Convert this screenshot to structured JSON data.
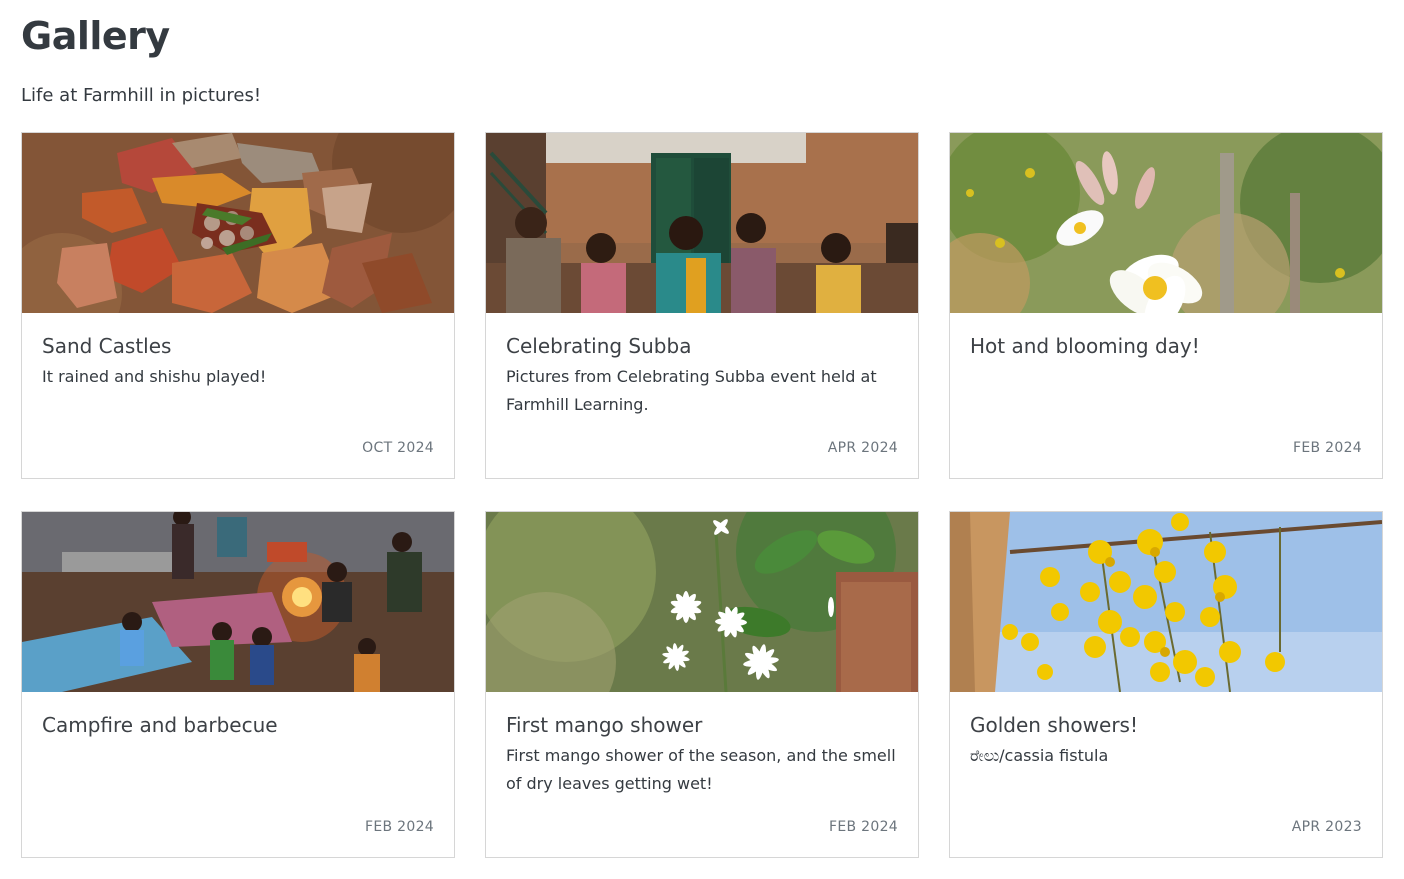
{
  "header": {
    "title": "Gallery",
    "subtitle": "Life at Farmhill in pictures!"
  },
  "cards": [
    {
      "title": "Sand Castles",
      "description": "It rained and shishu played!",
      "date": "OCT 2024",
      "image": "photo-leaves-and-stones-on-soil"
    },
    {
      "title": "Celebrating Subba",
      "description": "Pictures from Celebrating Subba event held at Farmhill Learning.",
      "date": "APR 2024",
      "image": "photo-people-sitting-outside-brick-building"
    },
    {
      "title": "Hot and blooming day!",
      "description": "",
      "date": "FEB 2024",
      "image": "photo-white-frangipani-flower"
    },
    {
      "title": "Campfire and barbecue",
      "description": "",
      "date": "FEB 2024",
      "image": "photo-children-around-campfire-at-night"
    },
    {
      "title": "First mango shower",
      "description": "First mango shower of the season, and the smell of dry leaves getting wet!",
      "date": "FEB 2024",
      "image": "photo-white-jasmine-flowers"
    },
    {
      "title": "Golden showers!",
      "description": "ರೇಲು/cassia fistula",
      "date": "APR 2023",
      "image": "photo-yellow-cassia-blossoms-sky"
    }
  ]
}
